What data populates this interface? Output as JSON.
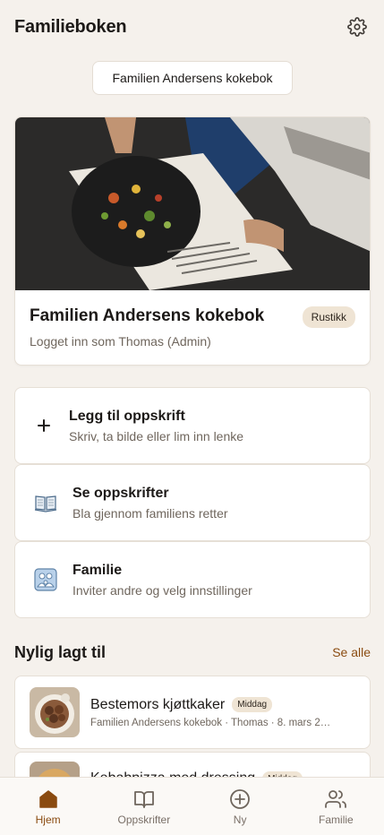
{
  "header": {
    "title": "Familieboken",
    "settings_icon": "gear-icon"
  },
  "switcher": {
    "label": "Familien Andersens kokebok"
  },
  "hero": {
    "title": "Familien Andersens kokebok",
    "subtitle": "Logget inn som Thomas (Admin)",
    "badge": "Rustikk"
  },
  "actions": [
    {
      "icon": "plus-icon",
      "title": "Legg til oppskrift",
      "subtitle": "Skriv, ta bilde eller lim inn lenke"
    },
    {
      "icon": "open-book-icon",
      "title": "Se oppskrifter",
      "subtitle": "Bla gjennom familiens retter"
    },
    {
      "icon": "family-icon",
      "title": "Familie",
      "subtitle": "Inviter andre og velg innstillinger"
    }
  ],
  "recent": {
    "title": "Nylig lagt til",
    "see_all": "Se alle",
    "items": [
      {
        "title": "Bestemors kjøttkaker",
        "category": "Middag",
        "meta": "Familien Andersens kokebok · Thomas · 8. mars 2…"
      },
      {
        "title": "Kebabpizza med dressing",
        "category": "Middag",
        "meta": ""
      }
    ]
  },
  "nav": [
    {
      "label": "Hjem",
      "icon": "home-icon",
      "active": true
    },
    {
      "label": "Oppskrifter",
      "icon": "book-icon",
      "active": false
    },
    {
      "label": "Ny",
      "icon": "plus-circle-icon",
      "active": false
    },
    {
      "label": "Familie",
      "icon": "users-icon",
      "active": false
    }
  ],
  "colors": {
    "accent": "#8a4b10",
    "background": "#f5f1ec",
    "badge": "#efe4d4"
  }
}
